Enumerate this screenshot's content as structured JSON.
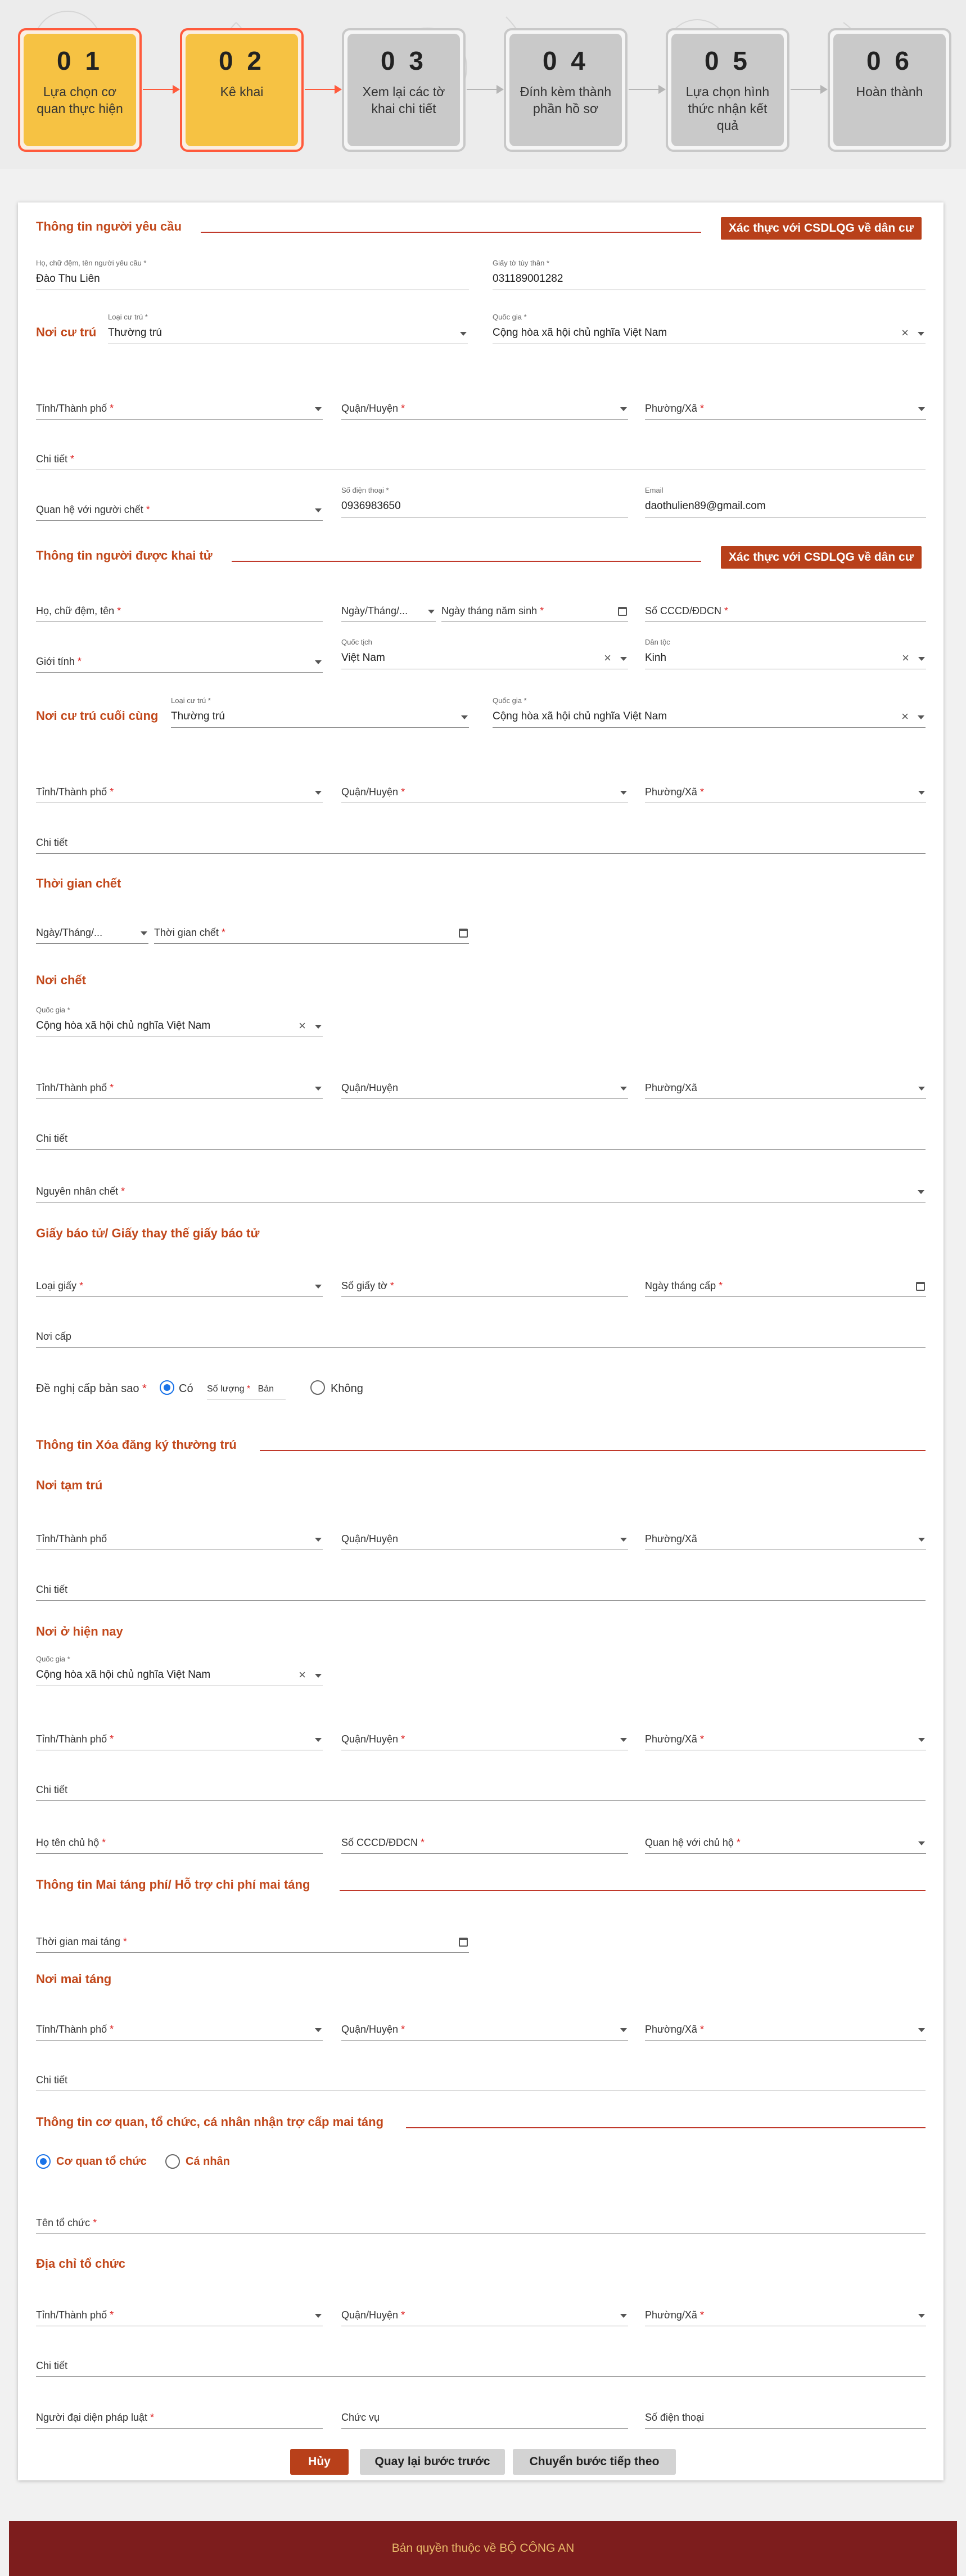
{
  "steps": [
    {
      "num": "0 1",
      "label": "Lựa chọn cơ quan thực hiện",
      "active": true
    },
    {
      "num": "0 2",
      "label": "Kê khai",
      "active": true
    },
    {
      "num": "0 3",
      "label": "Xem lại các tờ khai chi tiết",
      "active": false
    },
    {
      "num": "0 4",
      "label": "Đính kèm thành phần hồ sơ",
      "active": false
    },
    {
      "num": "0 5",
      "label": "Lựa chọn hình thức nhận kết quả",
      "active": false
    },
    {
      "num": "0 6",
      "label": "Hoàn thành",
      "active": false
    }
  ],
  "s1": {
    "title": "Thông tin người yêu cầu",
    "verify": "Xác thực với CSDLQG về dân cư",
    "name_cap": "Họ, chữ đệm, tên người yêu cầu *",
    "name_val": "Đào Thu Liên",
    "id_cap": "Giấy tờ tùy thân *",
    "id_val": "031189001282",
    "res_label": "Nơi cư trú",
    "res_type_cap": "Loại cư trú *",
    "res_type_val": "Thường trú",
    "country_cap": "Quốc gia *",
    "country_val": "Cộng hòa xã hội chủ nghĩa Việt Nam",
    "prov": "Tỉnh/Thành phố",
    "dist": "Quận/Huyện",
    "ward": "Phường/Xã",
    "detail": "Chi tiết",
    "rel": "Quan hệ với người chết",
    "phone_cap": "Số điện thoại *",
    "phone_val": "0936983650",
    "email_cap": "Email",
    "email_val": "daothulien89@gmail.com"
  },
  "s2": {
    "title": "Thông tin người được khai tử",
    "verify": "Xác thực với CSDLQG về dân cư",
    "name": "Họ, chữ đệm, tên",
    "dfmt": "Ngày/Tháng/...",
    "dob": "Ngày tháng năm sinh",
    "cccd": "Số CCCD/ĐDCN",
    "gender": "Giới tính",
    "nat_cap": "Quốc tịch",
    "nat_val": "Việt Nam",
    "eth_cap": "Dân tộc",
    "eth_val": "Kinh",
    "res_label": "Nơi cư trú cuối cùng",
    "res_type_cap": "Loại cư trú *",
    "res_type_val": "Thường trú",
    "country_cap": "Quốc gia *",
    "country_val": "Cộng hòa xã hội chủ nghĩa Việt Nam",
    "prov": "Tỉnh/Thành phố",
    "dist": "Quận/Huyện",
    "ward": "Phường/Xã",
    "detail": "Chi tiết"
  },
  "s3": {
    "title": "Thời gian chết",
    "dfmt": "Ngày/Tháng/...",
    "time": "Thời gian chết"
  },
  "s4": {
    "title": "Nơi chết",
    "country_cap": "Quốc gia *",
    "country_val": "Cộng hòa xã hội chủ nghĩa Việt Nam",
    "prov": "Tỉnh/Thành phố",
    "dist": "Quận/Huyện",
    "ward": "Phường/Xã",
    "detail": "Chi tiết",
    "cause": "Nguyên nhân chết"
  },
  "s5": {
    "title": "Giấy báo tử/ Giấy thay thế giấy báo tử",
    "type": "Loại giấy",
    "num": "Số giấy tờ",
    "date": "Ngày tháng cấp",
    "place": "Nơi cấp",
    "copy": "Đề nghị cấp bản sao",
    "yes": "Có",
    "qty": "Số lượng",
    "unit": "Bản",
    "no": "Không"
  },
  "s6": {
    "title": "Thông tin Xóa đăng ký thường trú"
  },
  "s7": {
    "title": "Nơi tạm trú",
    "prov": "Tỉnh/Thành phố",
    "dist": "Quận/Huyện",
    "ward": "Phường/Xã",
    "detail": "Chi tiết"
  },
  "s8": {
    "title": "Nơi ở hiện nay",
    "country_cap": "Quốc gia *",
    "country_val": "Cộng hòa xã hội chủ nghĩa Việt Nam",
    "prov": "Tỉnh/Thành phố",
    "dist": "Quận/Huyện",
    "ward": "Phường/Xã",
    "detail": "Chi tiết",
    "head": "Họ tên chủ hộ",
    "hcccd": "Số CCCD/ĐDCN",
    "hrel": "Quan hệ với chủ hộ"
  },
  "s9": {
    "title": "Thông tin Mai táng phí/ Hỗ trợ chi phí mai táng",
    "time": "Thời gian mai táng"
  },
  "s10": {
    "title": "Nơi mai táng",
    "prov": "Tỉnh/Thành phố",
    "dist": "Quận/Huyện",
    "ward": "Phường/Xã",
    "detail": "Chi tiết"
  },
  "s11": {
    "title": "Thông tin cơ quan, tổ chức, cá nhân nhận trợ cấp mai táng",
    "org": "Cơ quan tổ chức",
    "person": "Cá nhân",
    "orgname": "Tên tổ chức"
  },
  "s12": {
    "title": "Địa chỉ tổ chức",
    "prov": "Tỉnh/Thành phố",
    "dist": "Quận/Huyện",
    "ward": "Phường/Xã",
    "detail": "Chi tiết",
    "rep": "Người đại diện pháp luật",
    "pos": "Chức vụ",
    "phone": "Số điện thoại"
  },
  "buttons": {
    "cancel": "Hủy",
    "back": "Quay lại bước trước",
    "next": "Chuyển bước tiếp theo"
  },
  "footer": "Bản quyền thuộc về BỘ CÔNG AN",
  "colors": {
    "accent": "#c2481b",
    "active_step": "#f6c243",
    "footer": "#7d1d1d"
  }
}
